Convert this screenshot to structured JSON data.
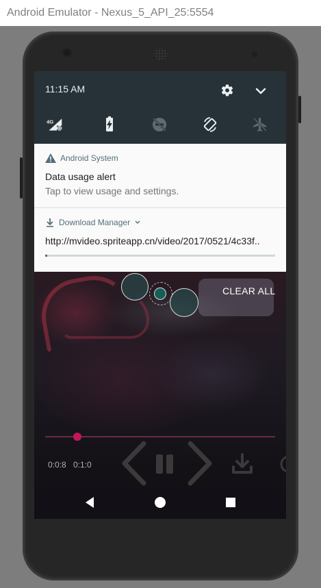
{
  "window": {
    "title": "Android Emulator - Nexus_5_API_25:5554"
  },
  "quick_settings": {
    "time": "11:15 AM",
    "tiles": [
      {
        "icon": "network-4g-no-data-icon",
        "label": "4G"
      },
      {
        "icon": "battery-charging-icon"
      },
      {
        "icon": "do-not-disturb-off-icon"
      },
      {
        "icon": "auto-rotate-icon"
      },
      {
        "icon": "airplane-mode-off-icon"
      }
    ]
  },
  "notifications": [
    {
      "app": "Android System",
      "app_icon": "warning-icon",
      "title": "Data usage alert",
      "text": "Tap to view usage and settings."
    },
    {
      "app": "Download Manager",
      "app_icon": "download-icon",
      "url": "http://mvideo.spriteapp.cn/video/2017/0521/4c33f..",
      "progress": 0.01
    }
  ],
  "clear_all_label": "CLEAR ALL",
  "player": {
    "current_time": "0:0:8",
    "total_time": "0:1:0",
    "seek_fraction": 0.14
  },
  "colors": {
    "qs_background": "#263238",
    "notification_background": "#fafafa",
    "accent": "#c2185b",
    "secondary_text": "#546e7a"
  }
}
